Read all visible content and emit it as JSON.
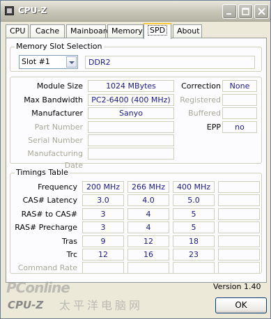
{
  "window": {
    "title": "CPU-Z",
    "footer_logo": "CPU-Z"
  },
  "tabs": [
    {
      "label": "CPU",
      "active": false
    },
    {
      "label": "Cache",
      "active": false
    },
    {
      "label": "Mainboard",
      "active": false
    },
    {
      "label": "Memory",
      "active": false
    },
    {
      "label": "SPD",
      "active": true
    },
    {
      "label": "About",
      "active": false
    }
  ],
  "slot_section": {
    "title": "Memory Slot Selection",
    "slot_value": "Slot #1",
    "memory_type": "DDR2"
  },
  "module": {
    "size_label": "Module Size",
    "size_value": "1024 MBytes",
    "bandwidth_label": "Max Bandwidth",
    "bandwidth_value": "PC2-6400 (400 MHz)",
    "manufacturer_label": "Manufacturer",
    "manufacturer_value": "Sanyo",
    "part_label": "Part Number",
    "part_value": "",
    "serial_label": "Serial Number",
    "serial_value": "",
    "date_label": "Manufacturing Date",
    "date_value": "",
    "correction_label": "Correction",
    "correction_value": "None",
    "registered_label": "Registered",
    "registered_value": "",
    "buffered_label": "Buffered",
    "buffered_value": "",
    "epp_label": "EPP",
    "epp_value": "no"
  },
  "timings": {
    "title": "Timings Table",
    "rows": [
      {
        "label": "Frequency",
        "values": [
          "200 MHz",
          "266 MHz",
          "400 MHz",
          ""
        ],
        "dim": false
      },
      {
        "label": "CAS# Latency",
        "values": [
          "3.0",
          "4.0",
          "5.0",
          ""
        ],
        "dim": false
      },
      {
        "label": "RAS# to CAS#",
        "values": [
          "3",
          "4",
          "5",
          ""
        ],
        "dim": false
      },
      {
        "label": "RAS# Precharge",
        "values": [
          "3",
          "4",
          "5",
          ""
        ],
        "dim": false
      },
      {
        "label": "Tras",
        "values": [
          "9",
          "12",
          "18",
          ""
        ],
        "dim": false
      },
      {
        "label": "Trc",
        "values": [
          "12",
          "16",
          "23",
          ""
        ],
        "dim": false
      },
      {
        "label": "Command Rate",
        "values": [
          "",
          "",
          "",
          ""
        ],
        "dim": true
      }
    ]
  },
  "version_label": "Version 1.40",
  "ok_label": "OK",
  "watermark": {
    "brand": "PConline",
    "tagline": "太平洋电脑网"
  }
}
